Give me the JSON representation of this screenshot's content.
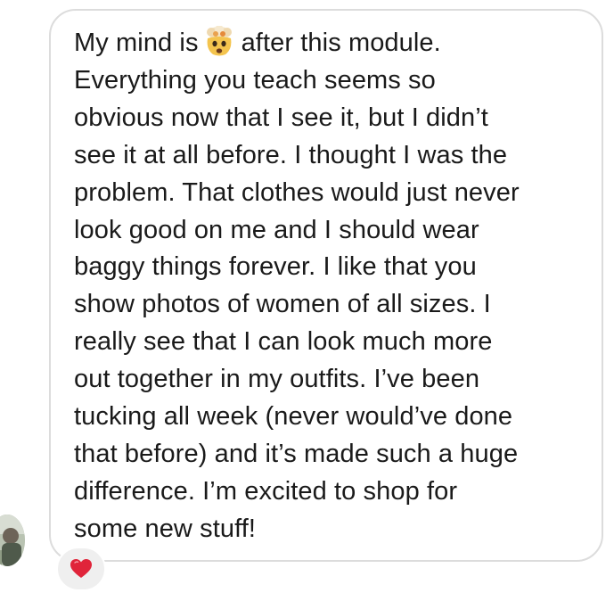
{
  "message": {
    "line1_before": "My mind is",
    "emoji": "exploding-head-emoji",
    "line1_after": "after this module.",
    "lines": [
      "Everything you teach seems so",
      "obvious now that I see it, but I didn’t",
      "see it at all before. I thought I was the",
      "problem. That clothes would just never",
      "look good on me and I should wear",
      "baggy things forever. I like that you",
      "show photos of women of all sizes. I",
      "really see that I can look much more",
      "out together in my outfits. I’ve been",
      "tucking all week (never would’ve done",
      "that before) and it’s made such a huge",
      "difference. I’m excited to shop for",
      "some new stuff!"
    ]
  },
  "reaction": {
    "icon": "heart-icon",
    "color": "#e0243a"
  },
  "colors": {
    "bubble_border": "#dcdcdc",
    "text": "#1a1a1a",
    "reaction_bg": "#efefef"
  }
}
